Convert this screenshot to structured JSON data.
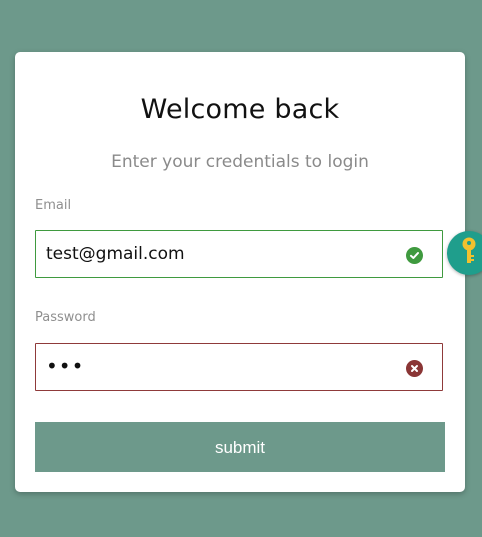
{
  "login": {
    "title": "Welcome back",
    "subtitle": "Enter your credentials to login",
    "email_label": "Email",
    "email_value": "test@gmail.com",
    "email_status": "valid",
    "password_label": "Password",
    "password_value": "•••",
    "password_status": "invalid",
    "submit_label": "submit"
  },
  "icons": {
    "email_status_icon": "check-circle-icon",
    "password_status_icon": "x-circle-icon",
    "extension_icon": "key-icon"
  },
  "colors": {
    "background": "#6d998b",
    "valid": "#3f9a3f",
    "invalid": "#8f3a3a",
    "extension": "#1f9e8c",
    "key": "#f2c12e"
  }
}
